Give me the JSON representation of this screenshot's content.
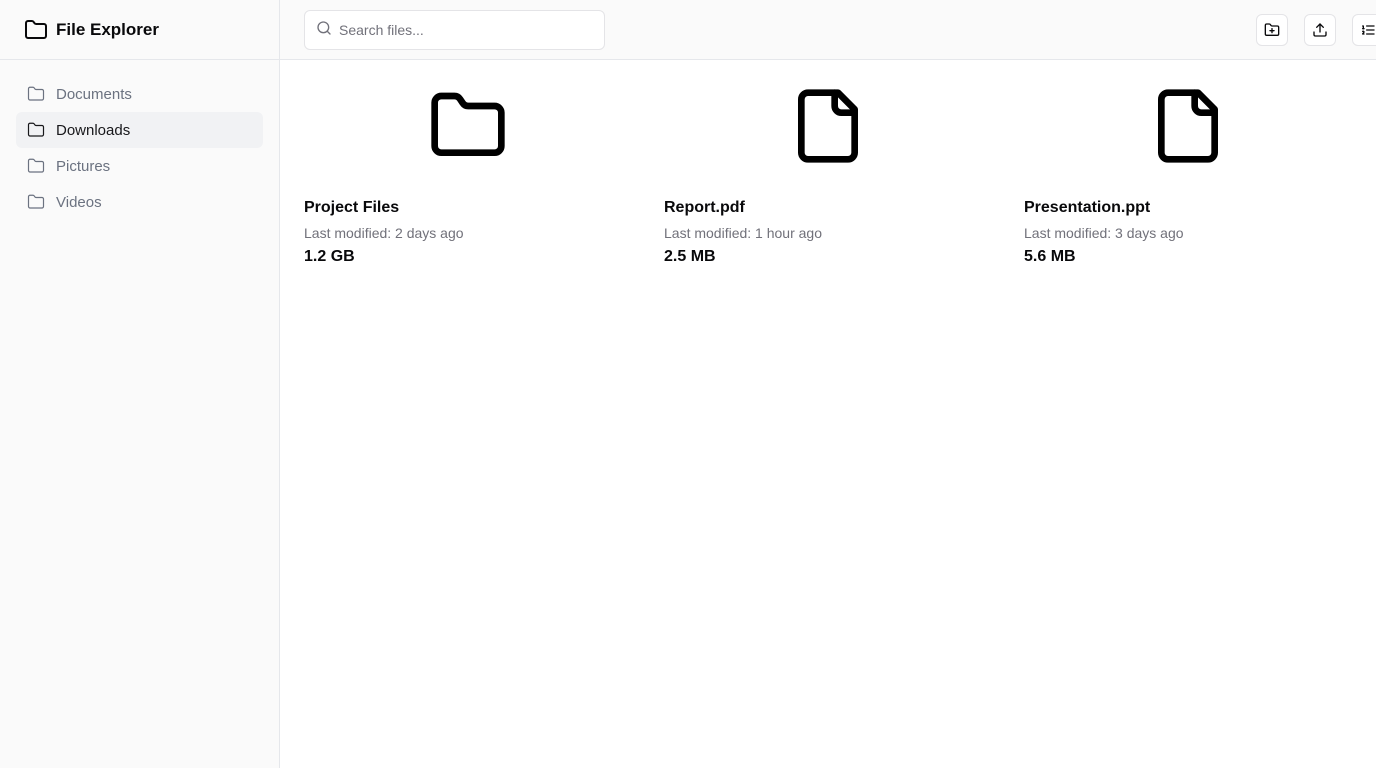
{
  "app": {
    "title": "File Explorer",
    "icon": "folder-icon"
  },
  "sidebar": {
    "items": [
      {
        "label": "Documents",
        "icon": "folder-icon",
        "active": false
      },
      {
        "label": "Downloads",
        "icon": "folder-icon",
        "active": true
      },
      {
        "label": "Pictures",
        "icon": "folder-icon",
        "active": false
      },
      {
        "label": "Videos",
        "icon": "folder-icon",
        "active": false
      }
    ]
  },
  "toolbar": {
    "search": {
      "placeholder": "Search files...",
      "value": ""
    },
    "buttons": [
      {
        "icon": "folder-plus-icon"
      },
      {
        "icon": "upload-icon"
      },
      {
        "icon": "list-view-icon"
      }
    ]
  },
  "files": [
    {
      "name": "Project Files",
      "modified": "Last modified: 2 days ago",
      "size": "1.2 GB",
      "icon": "folder-icon"
    },
    {
      "name": "Report.pdf",
      "modified": "Last modified: 1 hour ago",
      "size": "2.5 MB",
      "icon": "file-icon"
    },
    {
      "name": "Presentation.ppt",
      "modified": "Last modified: 3 days ago",
      "size": "5.6 MB",
      "icon": "file-icon"
    }
  ],
  "colors": {
    "sidebar_bg": "#fafafa",
    "active_item_bg": "#f1f2f4",
    "border": "#e5e7eb",
    "muted_text": "#71717a"
  }
}
